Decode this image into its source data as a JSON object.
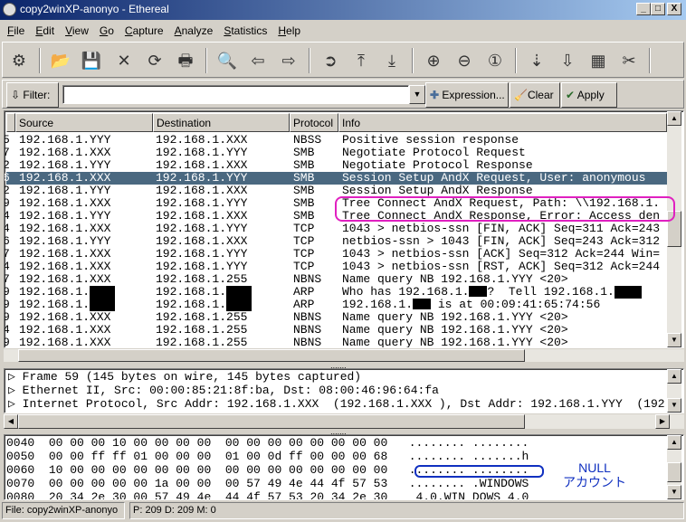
{
  "window": {
    "title": "copy2winXP-anonyo - Ethereal",
    "controls": [
      "_",
      "□",
      "X"
    ]
  },
  "menu": [
    "File",
    "Edit",
    "View",
    "Go",
    "Capture",
    "Analyze",
    "Statistics",
    "Help"
  ],
  "toolbar": [
    {
      "name": "capture-options-icon",
      "glyph": "⚙"
    },
    {
      "name": "open-icon",
      "glyph": "📂"
    },
    {
      "name": "save-icon",
      "glyph": "💾"
    },
    {
      "name": "close-icon",
      "glyph": "✕"
    },
    {
      "name": "reload-icon",
      "glyph": "⟳"
    },
    {
      "name": "print-icon",
      "glyph": "🖶"
    },
    {
      "name": "find-icon",
      "glyph": "🔍"
    },
    {
      "name": "back-icon",
      "glyph": "⇦"
    },
    {
      "name": "forward-icon",
      "glyph": "⇨"
    },
    {
      "name": "goto-icon",
      "glyph": "➲"
    },
    {
      "name": "first-icon",
      "glyph": "⤒"
    },
    {
      "name": "last-icon",
      "glyph": "⤓"
    },
    {
      "name": "zoom-in-icon",
      "glyph": "⊕"
    },
    {
      "name": "zoom-out-icon",
      "glyph": "⊖"
    },
    {
      "name": "zoom-normal-icon",
      "glyph": "①"
    },
    {
      "name": "capture-filters-icon",
      "glyph": "⇣"
    },
    {
      "name": "display-filters-icon",
      "glyph": "⇩"
    },
    {
      "name": "coloring-rules-icon",
      "glyph": "▦"
    },
    {
      "name": "preferences-icon",
      "glyph": "✂"
    }
  ],
  "filter": {
    "label": "Filter:",
    "value": "",
    "expression": "Expression...",
    "clear": "Clear",
    "apply": "Apply"
  },
  "packet_list": {
    "columns": [
      "Source",
      "Destination",
      "Protocol",
      "Info"
    ],
    "rows": [
      {
        "no": "5",
        "src": "192.168.1.YYY",
        "dst": "192.168.1.XXX",
        "proto": "NBSS",
        "info": "Positive session response"
      },
      {
        "no": "7",
        "src": "192.168.1.XXX",
        "dst": "192.168.1.YYY",
        "proto": "SMB",
        "info": "Negotiate Protocol Request"
      },
      {
        "no": "2",
        "src": "192.168.1.YYY",
        "dst": "192.168.1.XXX",
        "proto": "SMB",
        "info": "Negotiate Protocol Response"
      },
      {
        "no": "6",
        "src": "192.168.1.XXX",
        "dst": "192.168.1.YYY",
        "proto": "SMB",
        "info": "Session Setup AndX Request, User: anonymous",
        "selected": true
      },
      {
        "no": "2",
        "src": "192.168.1.YYY",
        "dst": "192.168.1.XXX",
        "proto": "SMB",
        "info": "Session Setup AndX Response"
      },
      {
        "no": "9",
        "src": "192.168.1.XXX",
        "dst": "192.168.1.YYY",
        "proto": "SMB",
        "info": "Tree Connect AndX Request, Path: \\\\192.168.1."
      },
      {
        "no": "4",
        "src": "192.168.1.YYY",
        "dst": "192.168.1.XXX",
        "proto": "SMB",
        "info": "Tree Connect AndX Response, Error: Access den"
      },
      {
        "no": "4",
        "src": "192.168.1.XXX",
        "dst": "192.168.1.YYY",
        "proto": "TCP",
        "info": "1043 > netbios-ssn [FIN, ACK] Seq=311 Ack=243"
      },
      {
        "no": "6",
        "src": "192.168.1.YYY",
        "dst": "192.168.1.XXX",
        "proto": "TCP",
        "info": "netbios-ssn > 1043 [FIN, ACK] Seq=243 Ack=312"
      },
      {
        "no": "7",
        "src": "192.168.1.XXX",
        "dst": "192.168.1.YYY",
        "proto": "TCP",
        "info": "1043 > netbios-ssn [ACK] Seq=312 Ack=244 Win="
      },
      {
        "no": "4",
        "src": "192.168.1.XXX",
        "dst": "192.168.1.YYY",
        "proto": "TCP",
        "info": "1043 > netbios-ssn [RST, ACK] Seq=312 Ack=244"
      },
      {
        "no": "7",
        "src": "192.168.1.XXX",
        "dst": "192.168.1.255",
        "proto": "NBNS",
        "info": "Name query NB 192.168.1.YYY <20>"
      },
      {
        "no": "9",
        "src": "192.168.1.",
        "dst": "192.168.1.",
        "proto": "ARP",
        "info": "Who has 192.168.1.",
        "info2": "?  Tell 192.168.1.",
        "redacted": true
      },
      {
        "no": "9",
        "src": "192.168.1.",
        "dst": "192.168.1.",
        "proto": "ARP",
        "info": "192.168.1.",
        "info2": " is at 00:09:41:65:74:56",
        "redacted": true
      },
      {
        "no": "9",
        "src": "192.168.1.XXX",
        "dst": "192.168.1.255",
        "proto": "NBNS",
        "info": "Name query NB 192.168.1.YYY <20>"
      },
      {
        "no": "4",
        "src": "192.168.1.XXX",
        "dst": "192.168.1.255",
        "proto": "NBNS",
        "info": "Name query NB 192.168.1.YYY <20>"
      },
      {
        "no": "9",
        "src": "192.168.1.XXX",
        "dst": "192.168.1.255",
        "proto": "NBNS",
        "info": "Name query NB 192.168.1.YYY <20>"
      }
    ]
  },
  "details": [
    "Frame 59 (145 bytes on wire, 145 bytes captured)",
    "Ethernet II, Src: 00:00:85:21:8f:ba, Dst: 08:00:46:96:64:fa",
    "Internet Protocol, Src Addr: 192.168.1.XXX  (192.168.1.XXX ), Dst Addr: 192.168.1.YYY  (192."
  ],
  "hex": [
    {
      "off": "0040",
      "bytes": "00 00 00 10 00 00 00 00  00 00 00 00 00 00 00 00",
      "ascii": "........ ........"
    },
    {
      "off": "0050",
      "bytes": "00 00 ff ff 01 00 00 00  01 00 0d ff 00 00 00 68",
      "ascii": "........ .......h"
    },
    {
      "off": "0060",
      "bytes": "10 00 00 00 00 00 00 00  00 00 00 00 00 00 00 00",
      "ascii": "........ ........"
    },
    {
      "off": "0070",
      "bytes": "00 00 00 00 00 1a 00 00  00 57 49 4e 44 4f 57 53",
      "ascii": "........ .WINDOWS"
    },
    {
      "off": "0080",
      "bytes": "20 34 2e 30 00 57 49 4e  44 4f 57 53 20 34 2e 30",
      "ascii": " 4.0.WIN DOWS 4.0"
    }
  ],
  "annotation": {
    "line1": "NULL",
    "line2": "アカウント",
    "color": "#1030c0",
    "highlight_color": "#e020c0"
  },
  "status": {
    "file": "File: copy2winXP-anonyo",
    "counts": "P: 209 D: 209 M: 0"
  },
  "colors": {
    "selected_row": "#4a6880",
    "title_bar": "#0a246a"
  }
}
